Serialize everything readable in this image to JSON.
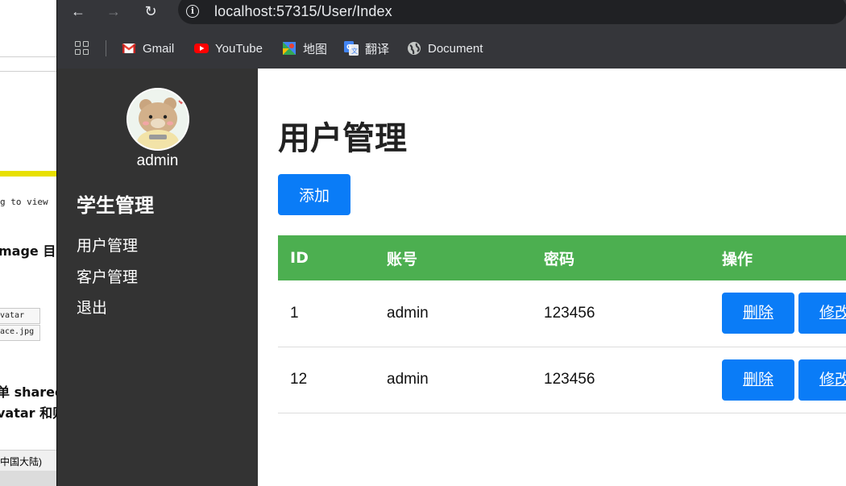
{
  "background_doc": {
    "snippet_1": "g to view",
    "snippet_2": "mage 目",
    "snippet_3": "vatar",
    "snippet_4": "ace.jpg",
    "snippet_5": "单 shared",
    "snippet_6": "vatar 和则",
    "status_text": "中国大陆)"
  },
  "browser": {
    "url": "localhost:57315/User/Index",
    "bookmarks": [
      {
        "label": "Gmail",
        "icon": "gmail-icon"
      },
      {
        "label": "YouTube",
        "icon": "youtube-icon"
      },
      {
        "label": "地图",
        "icon": "maps-icon"
      },
      {
        "label": "翻译",
        "icon": "translate-icon"
      },
      {
        "label": "Document",
        "icon": "globe-icon"
      }
    ]
  },
  "sidebar": {
    "username": "admin",
    "section_title": "学生管理",
    "items": [
      {
        "label": "用户管理"
      },
      {
        "label": "客户管理"
      },
      {
        "label": "退出"
      }
    ]
  },
  "main": {
    "title": "用户管理",
    "add_label": "添加",
    "table": {
      "headers": [
        "ID",
        "账号",
        "密码",
        "操作"
      ],
      "rows": [
        {
          "id": "1",
          "account": "admin",
          "password": "123456",
          "delete_label": "删除",
          "edit_label": "修改"
        },
        {
          "id": "12",
          "account": "admin",
          "password": "123456",
          "delete_label": "删除",
          "edit_label": "修改"
        }
      ]
    }
  },
  "colors": {
    "sidebar_bg": "#333333",
    "header_green": "#4caf50",
    "button_blue": "#0a7cf7",
    "browser_chrome": "#35363a"
  }
}
